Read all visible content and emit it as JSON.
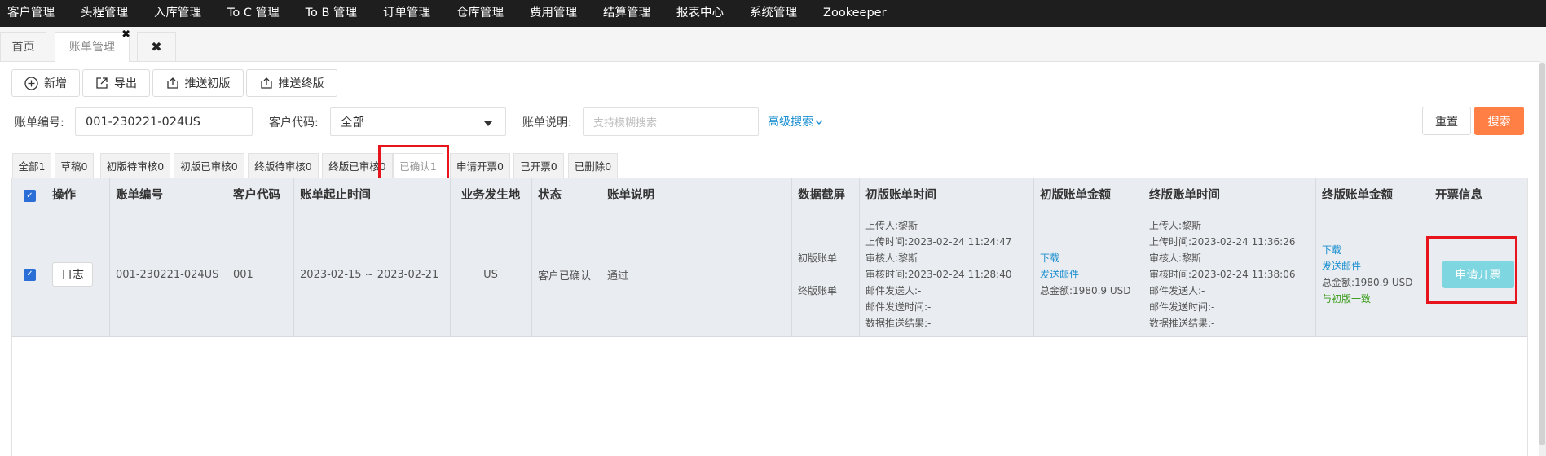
{
  "nav": {
    "items": [
      "客户管理",
      "头程管理",
      "入库管理",
      "To C 管理",
      "To B 管理",
      "订单管理",
      "仓库管理",
      "费用管理",
      "结算管理",
      "报表中心",
      "系统管理",
      "Zookeeper"
    ]
  },
  "tabs": {
    "home": "首页",
    "bill": "账单管理",
    "close_glyph": "✖"
  },
  "toolbar": {
    "add": "新增",
    "export": "导出",
    "push_first": "推送初版",
    "push_final": "推送终版"
  },
  "search": {
    "bill_no_label": "账单编号:",
    "bill_no_value": "001-230221-024US",
    "customer_code_label": "客户代码:",
    "customer_code_value": "全部",
    "bill_desc_label": "账单说明:",
    "bill_desc_placeholder": "支持模糊搜索",
    "advanced": "高级搜索",
    "reset": "重置",
    "search": "搜索"
  },
  "status_tabs": [
    "全部1",
    "草稿0",
    "初版待审核0",
    "初版已审核0",
    "终版待审核0",
    "终版已审核0",
    "已确认1",
    "申请开票0",
    "已开票0",
    "已删除0"
  ],
  "active_status_tab": "已确认1",
  "table": {
    "headers": [
      "操作",
      "账单编号",
      "客户代码",
      "账单起止时间",
      "业务发生地",
      "状态",
      "账单说明",
      "数据截屏",
      "初版账单时间",
      "初版账单金额",
      "终版账单时间",
      "终版账单金额",
      "开票信息"
    ],
    "row": {
      "log_btn": "日志",
      "bill_no": "001-230221-024US",
      "customer_code": "001",
      "period": "2023-02-15 ~ 2023-02-21",
      "location": "US",
      "status": "客户已确认",
      "desc": "通过",
      "screenshot_first": "初版账单",
      "screenshot_final": "终版账单",
      "first_time_lines": [
        "上传人:黎斯",
        "上传时间:2023-02-24 11:24:47",
        "审核人:黎斯",
        "审核时间:2023-02-24 11:28:40",
        "邮件发送人:-",
        "邮件发送时间:-",
        "数据推送结果:-"
      ],
      "first_amount_download": "下载",
      "first_amount_email": "发送邮件",
      "first_amount_total": "总金额:1980.9 USD",
      "final_time_lines": [
        "上传人:黎斯",
        "上传时间:2023-02-24 11:36:26",
        "审核人:黎斯",
        "审核时间:2023-02-24 11:38:06",
        "邮件发送人:-",
        "邮件发送时间:-",
        "数据推送结果:-"
      ],
      "final_amount_download": "下载",
      "final_amount_email": "发送邮件",
      "final_amount_total": "总金额:1980.9 USD",
      "final_amount_consistent": "与初版一致",
      "invoice_btn": "申请开票"
    }
  },
  "colors": {
    "nav_bg": "#1e1e1e",
    "link": "#1a8fd0",
    "search_btn": "#ff7f45",
    "invoice_btn": "#7ed6e0",
    "highlight": "#e8141b",
    "checkbox": "#2b6fd6",
    "consistent": "#3c9d1e"
  }
}
